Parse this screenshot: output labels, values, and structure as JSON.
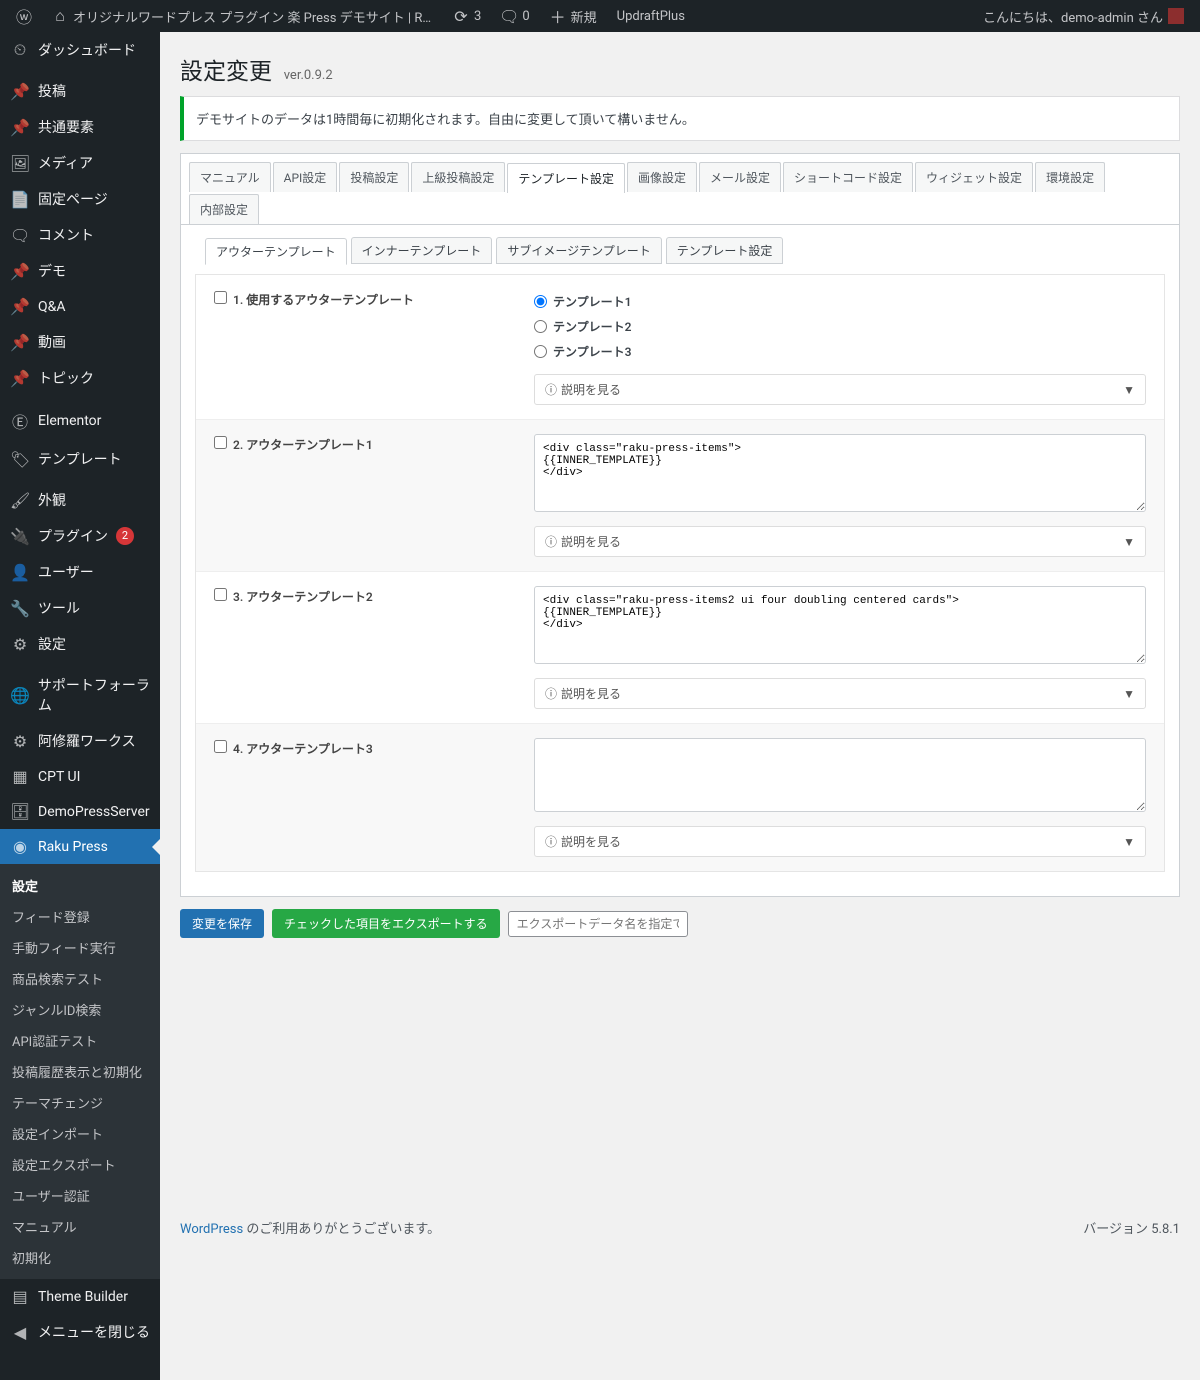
{
  "adminbar": {
    "site_title": "オリジナルワードプレス プラグイン 楽 Press デモサイト | Raku P...",
    "updates_count": "3",
    "comments_count": "0",
    "new_label": "新規",
    "updraft_label": "UpdraftPlus",
    "greeting": "こんにちは、demo-admin さん"
  },
  "sidebar": {
    "dashboard": "ダッシュボード",
    "posts": "投稿",
    "common_elem": "共通要素",
    "media": "メディア",
    "pages": "固定ページ",
    "comments": "コメント",
    "demo": "デモ",
    "qa": "Q&A",
    "videos": "動画",
    "topics": "トピック",
    "elementor": "Elementor",
    "templates": "テンプレート",
    "appearance": "外観",
    "plugins": "プラグイン",
    "plugins_badge": "2",
    "users": "ユーザー",
    "tools": "ツール",
    "settings": "設定",
    "support_forum": "サポートフォーラム",
    "ashura": "阿修羅ワークス",
    "cptui": "CPT UI",
    "demopress": "DemoPressServer",
    "rakupress": "Raku Press",
    "theme_builder": "Theme Builder",
    "collapse": "メニューを閉じる"
  },
  "submenu": {
    "settings": "設定",
    "feed_register": "フィード登録",
    "manual_feed": "手動フィード実行",
    "product_search": "商品検索テスト",
    "genre_search": "ジャンルID検索",
    "api_auth": "API認証テスト",
    "history_init": "投稿履歴表示と初期化",
    "theme_change": "テーマチェンジ",
    "import": "設定インポート",
    "export": "設定エクスポート",
    "user_auth": "ユーザー認証",
    "manual": "マニュアル",
    "init": "初期化"
  },
  "page": {
    "title": "設定変更",
    "version": "ver.0.9.2",
    "notice": "デモサイトのデータは1時間毎に初期化されます。自由に変更して頂いて構いません。"
  },
  "tabs": {
    "manual": "マニュアル",
    "api": "API設定",
    "post": "投稿設定",
    "adv_post": "上級投稿設定",
    "template": "テンプレート設定",
    "image": "画像設定",
    "mail": "メール設定",
    "shortcode": "ショートコード設定",
    "widget": "ウィジェット設定",
    "env": "環境設定",
    "internal": "内部設定"
  },
  "subtabs": {
    "outer": "アウターテンプレート",
    "inner": "インナーテンプレート",
    "subimage": "サブイメージテンプレート",
    "template_settings": "テンプレート設定"
  },
  "rows": {
    "r1": {
      "label": "1. 使用するアウターテンプレート",
      "opt1": "テンプレート1",
      "opt2": "テンプレート2",
      "opt3": "テンプレート3"
    },
    "r2": {
      "label": "2. アウターテンプレート1",
      "value": "<div class=\"raku-press-items\">\n{{INNER_TEMPLATE}}\n</div>"
    },
    "r3": {
      "label": "3. アウターテンプレート2",
      "value": "<div class=\"raku-press-items2 ui four doubling centered cards\">\n{{INNER_TEMPLATE}}\n</div>"
    },
    "r4": {
      "label": "4. アウターテンプレート3",
      "value": ""
    },
    "help_label": "説明を見る"
  },
  "buttons": {
    "save": "変更を保存",
    "export_checked": "チェックした項目をエクスポートする",
    "export_placeholder": "エクスポートデータ名を指定できます"
  },
  "footer": {
    "thanks_pre": "WordPress",
    "thanks_post": " のご利用ありがとうございます。",
    "version": "バージョン 5.8.1"
  }
}
